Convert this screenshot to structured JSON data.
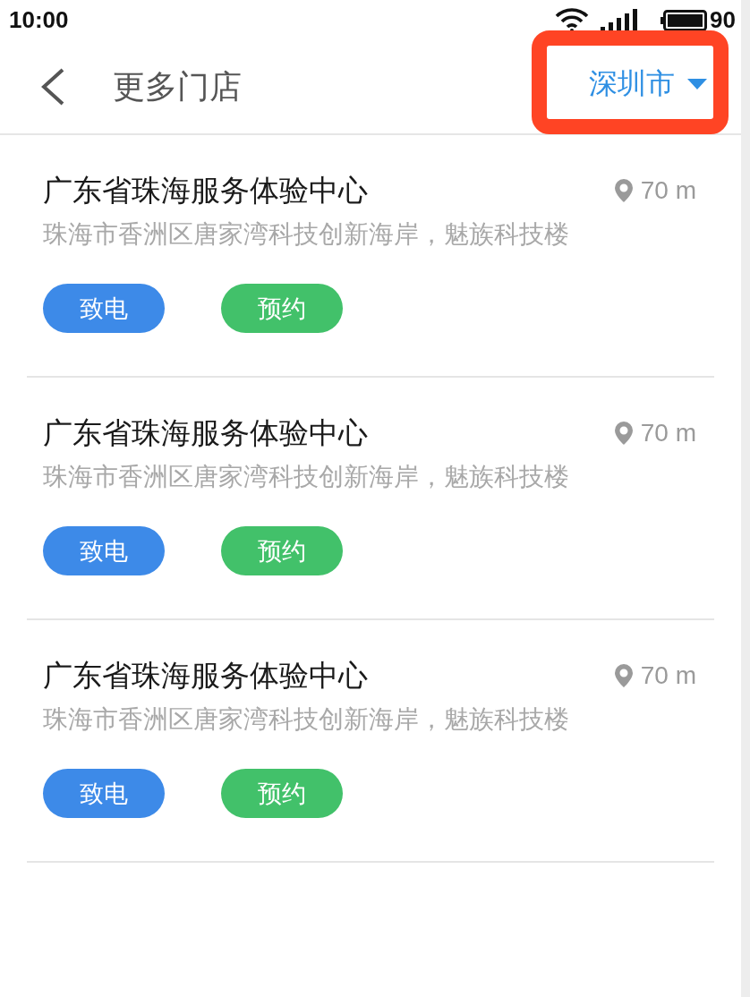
{
  "status_bar": {
    "time": "10:00",
    "battery": "90"
  },
  "header": {
    "title": "更多门店",
    "city": "深圳市",
    "city_highlighted": true
  },
  "stores": [
    {
      "name": "广东省珠海服务体验中心",
      "address": "珠海市香洲区唐家湾科技创新海岸，魅族科技楼",
      "distance": "70 m",
      "actions": [
        {
          "label": "致电",
          "kind": "call"
        },
        {
          "label": "预约",
          "kind": "book"
        }
      ]
    },
    {
      "name": "广东省珠海服务体验中心",
      "address": "珠海市香洲区唐家湾科技创新海岸，魅族科技楼",
      "distance": "70 m",
      "actions": [
        {
          "label": "致电",
          "kind": "call"
        },
        {
          "label": "预约",
          "kind": "book"
        }
      ]
    },
    {
      "name": "广东省珠海服务体验中心",
      "address": "珠海市香洲区唐家湾科技创新海岸，魅族科技楼",
      "distance": "70 m",
      "actions": [
        {
          "label": "致电",
          "kind": "call"
        },
        {
          "label": "预约",
          "kind": "book"
        }
      ]
    }
  ]
}
